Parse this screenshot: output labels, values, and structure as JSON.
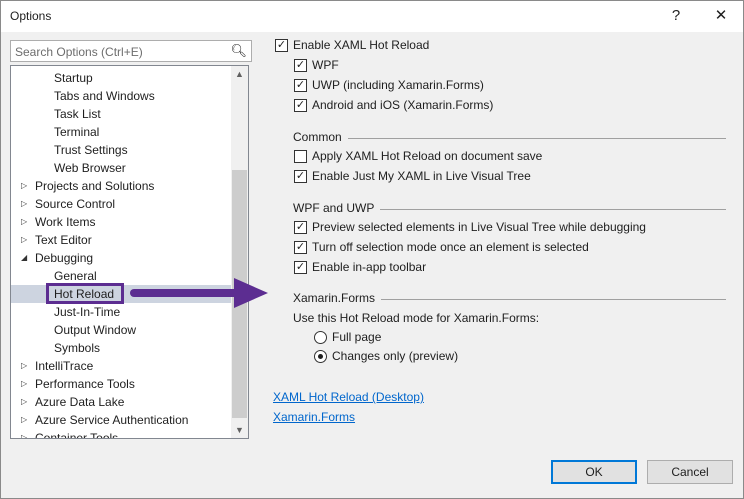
{
  "window": {
    "title": "Options",
    "help": "?",
    "close": "✕"
  },
  "search": {
    "placeholder": "Search Options (Ctrl+E)"
  },
  "tree": [
    {
      "label": "Startup",
      "level": 2
    },
    {
      "label": "Tabs and Windows",
      "level": 2
    },
    {
      "label": "Task List",
      "level": 2
    },
    {
      "label": "Terminal",
      "level": 2
    },
    {
      "label": "Trust Settings",
      "level": 2
    },
    {
      "label": "Web Browser",
      "level": 2
    },
    {
      "label": "Projects and Solutions",
      "level": 1
    },
    {
      "label": "Source Control",
      "level": 1
    },
    {
      "label": "Work Items",
      "level": 1
    },
    {
      "label": "Text Editor",
      "level": 1
    },
    {
      "label": "Debugging",
      "level": 1,
      "expanded": true
    },
    {
      "label": "General",
      "level": 2
    },
    {
      "label": "Hot Reload",
      "level": 2,
      "selected": true
    },
    {
      "label": "Just-In-Time",
      "level": 2
    },
    {
      "label": "Output Window",
      "level": 2
    },
    {
      "label": "Symbols",
      "level": 2
    },
    {
      "label": "IntelliTrace",
      "level": 1
    },
    {
      "label": "Performance Tools",
      "level": 1
    },
    {
      "label": "Azure Data Lake",
      "level": 1
    },
    {
      "label": "Azure Service Authentication",
      "level": 1
    },
    {
      "label": "Container Tools",
      "level": 1
    }
  ],
  "settings": {
    "enable": {
      "label": "Enable XAML Hot Reload",
      "checked": true
    },
    "wpf": {
      "label": "WPF",
      "checked": true
    },
    "uwp": {
      "label": "UWP (including Xamarin.Forms)",
      "checked": true
    },
    "android": {
      "label": "Android and iOS (Xamarin.Forms)",
      "checked": true
    },
    "common_header": "Common",
    "apply_save": {
      "label": "Apply XAML Hot Reload on document save",
      "checked": false
    },
    "just_my_xaml": {
      "label": "Enable Just My XAML in Live Visual Tree",
      "checked": true
    },
    "wpf_uwp_header": "WPF and UWP",
    "preview": {
      "label": "Preview selected elements in Live Visual Tree while debugging",
      "checked": true
    },
    "turn_off": {
      "label": "Turn off selection mode once an element is selected",
      "checked": true
    },
    "toolbar": {
      "label": "Enable in-app toolbar",
      "checked": true
    },
    "xamarin_header": "Xamarin.Forms",
    "mode_label": "Use this Hot Reload mode for Xamarin.Forms:",
    "full_page": {
      "label": "Full page",
      "selected": false
    },
    "changes_only": {
      "label": "Changes only (preview)",
      "selected": true
    }
  },
  "links": {
    "desktop": "XAML Hot Reload (Desktop)",
    "xamarin": "Xamarin.Forms"
  },
  "buttons": {
    "ok": "OK",
    "cancel": "Cancel"
  },
  "colors": {
    "annotation": "#5c2d91",
    "link": "#0066cc"
  }
}
